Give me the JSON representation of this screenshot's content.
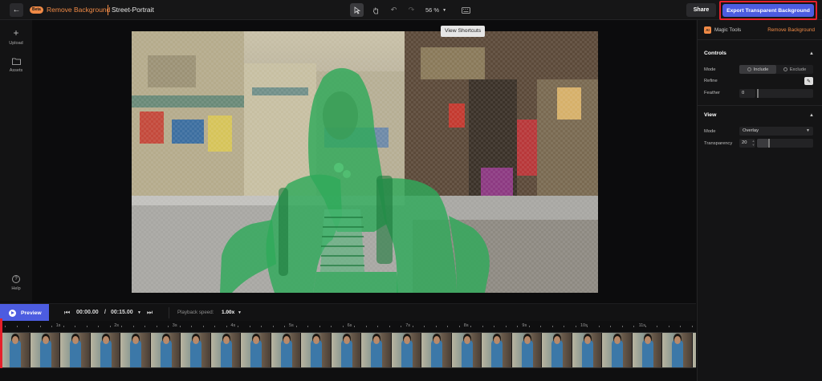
{
  "topbar": {
    "back_icon": "arrow-left-icon",
    "beta_badge": "Beta",
    "app_title": "Remove Background",
    "project_name": "Street-Portrait",
    "tools": [
      "select-icon",
      "hand-icon",
      "undo-icon",
      "redo-icon"
    ],
    "zoom": "56 %",
    "keyboard_icon": "keyboard-icon",
    "share_label": "Share",
    "export_label": "Export Transparent Background"
  },
  "tooltip": "View Shortcuts",
  "leftrail": {
    "upload_label": "Upload",
    "assets_label": "Assets",
    "help_label": "Help"
  },
  "rightpanel": {
    "ai_badge": "AI",
    "magic_tools_label": "Magic Tools",
    "remove_link": "Remove Background",
    "controls": {
      "title": "Controls",
      "mode_label": "Mode",
      "mode_options": [
        "Include",
        "Exclude"
      ],
      "mode_selected": "Include",
      "refine_label": "Refine",
      "feather_label": "Feather",
      "feather_value": "0"
    },
    "view": {
      "title": "View",
      "mode_label": "Mode",
      "mode_value": "Overlay",
      "transparency_label": "Transparency",
      "transparency_value": "20"
    }
  },
  "playbar": {
    "preview_label": "Preview",
    "current_time": "00:00.00",
    "time_separator": "/",
    "total_time": "00:15.00",
    "speed_label": "Playback speed:",
    "speed_value": "1.00x"
  },
  "ruler_labels": [
    "1s",
    "2s",
    "3s",
    "4s",
    "5s",
    "6s",
    "7s",
    "8s",
    "9s",
    "10s",
    "11s"
  ],
  "colors": {
    "accent_orange": "#f08a46",
    "accent_blue": "#4c5ce0",
    "highlight_red": "#e5202b",
    "mask_green": "#2faa5a"
  }
}
